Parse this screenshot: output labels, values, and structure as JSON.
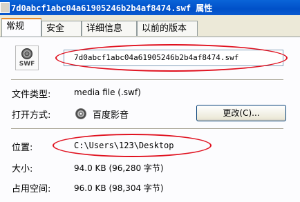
{
  "window": {
    "title": "7d0abcf1abc04a61905246b2b4af8474.swf 属性"
  },
  "tabs": [
    {
      "label": "常规"
    },
    {
      "label": "安全"
    },
    {
      "label": "详细信息"
    },
    {
      "label": "以前的版本"
    }
  ],
  "file": {
    "icon_label": "SWF",
    "name": "7d0abcf1abc04a61905246b2b4af8474.swf"
  },
  "rows": {
    "type_label": "文件类型:",
    "type_value": "media file (.swf)",
    "open_label": "打开方式:",
    "open_app": "百度影音",
    "change_button": "更改(C)...",
    "location_label": "位置:",
    "location_value": "C:\\Users\\123\\Desktop",
    "size_label": "大小:",
    "size_value": "94.0 KB (96,280 字节)",
    "disk_label": "占用空间:",
    "disk_value": "96.0 KB (98,304 字节)"
  },
  "colors": {
    "highlight_circle": "#e0101e",
    "title_bar": "#0054e3"
  }
}
